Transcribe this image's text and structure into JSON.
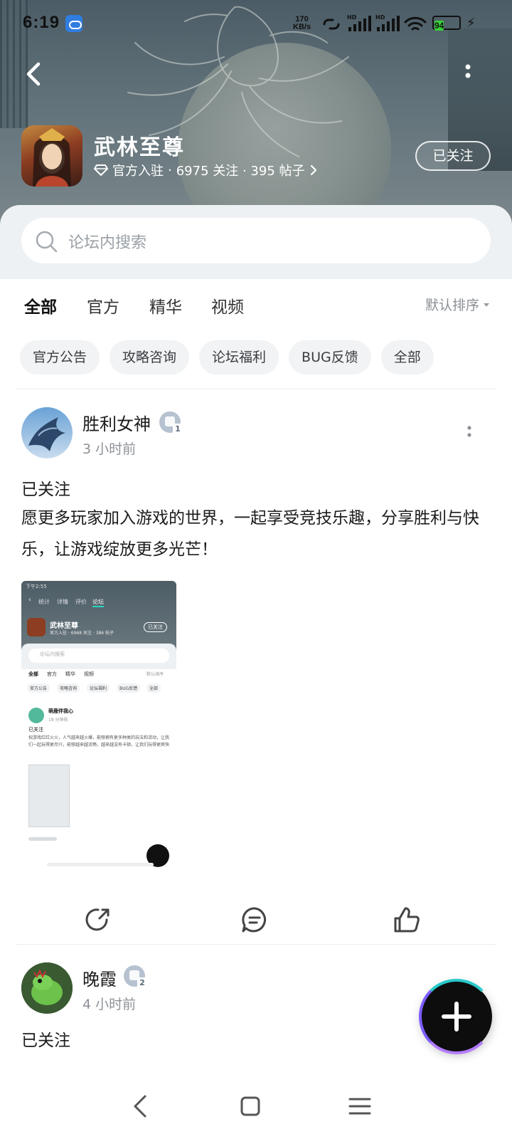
{
  "status_bar": {
    "time": "6:19",
    "net_speed_value": "170",
    "net_speed_unit": "KB/s",
    "hd_label": "HD",
    "battery": "94"
  },
  "header": {
    "game_name": "武林至尊",
    "official_label": "官方入驻",
    "stats": "6975 关注 · 395 帖子",
    "follow_button": "已关注"
  },
  "search": {
    "placeholder": "论坛内搜索"
  },
  "tabs": [
    {
      "label": "全部",
      "active": true
    },
    {
      "label": "官方",
      "active": false
    },
    {
      "label": "精华",
      "active": false
    },
    {
      "label": "视频",
      "active": false
    }
  ],
  "sort": {
    "label": "默认排序"
  },
  "chips": [
    "官方公告",
    "攻略咨询",
    "论坛福利",
    "BUG反馈",
    "全部"
  ],
  "posts": [
    {
      "author": "胜利女神",
      "level": "1",
      "time": "3 小时前",
      "follow_status": "已关注",
      "body": "愿更多玩家加入游戏的世界，一起享受竞技乐趣，分享胜利与快乐，让游戏绽放更多光芒！"
    },
    {
      "author": "晚霞",
      "level": "2",
      "time": "4 小时前",
      "follow_status": "已关注"
    }
  ],
  "thumbnail": {
    "time": "下午2:55",
    "tab_stats": "统计",
    "tab_detail": "详情",
    "tab_review": "评价",
    "tab_forum": "论坛",
    "game_name": "武林至尊",
    "stats": "官方入驻 · 6968 关注 · 386 帖子",
    "follow": "已关注",
    "search": "论坛内搜索",
    "tabs": [
      "全部",
      "官方",
      "精华",
      "视频"
    ],
    "sort": "默认排序",
    "chips": [
      "官方公告",
      "攻略咨询",
      "论坛福利",
      "BUG反馈",
      "全部"
    ],
    "author": "萌鹿伴我心",
    "post_time": "18 分钟前",
    "follow_status": "已关注",
    "body": "祝游戏红红火火，人气越来越火爆，能够拥有更多种类的玩法和活动，让我们一起玩得更尽兴，能够越来越流畅，越来越没有卡顿，让我们玩得更爽快"
  },
  "colors": {
    "accent_teal": "#2bd5c2",
    "fab": "#0d0d0d",
    "chip_bg": "#f1f3f5"
  },
  "icons": [
    "back-icon",
    "more-vertical-icon",
    "diamond-icon",
    "chevron-right-icon",
    "search-icon",
    "caret-down-icon",
    "share-icon",
    "comment-icon",
    "like-icon",
    "plus-icon",
    "nav-back-icon",
    "nav-home-icon",
    "nav-menu-icon"
  ]
}
